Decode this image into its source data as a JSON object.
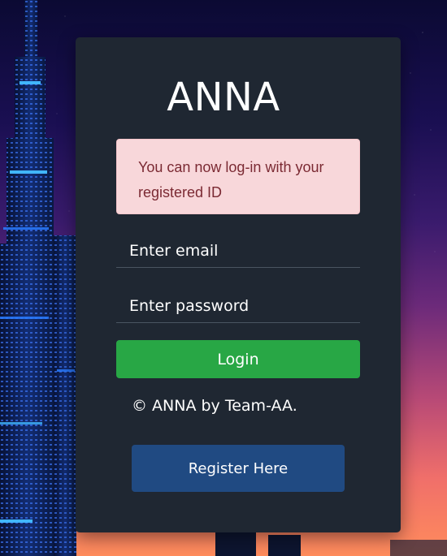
{
  "login": {
    "brand": "ANNA",
    "alert_message": "You can now log-in with your registered ID",
    "email_placeholder": "Enter email",
    "password_placeholder": "Enter password",
    "login_label": "Login",
    "footer_text": "© ANNA by Team-AA.",
    "register_label": "Register Here"
  },
  "colors": {
    "card_background": "#1f2732",
    "alert_background": "#f8d7da",
    "alert_text": "#7b2a33",
    "login_button": "#28a745",
    "register_button": "#204a82"
  }
}
